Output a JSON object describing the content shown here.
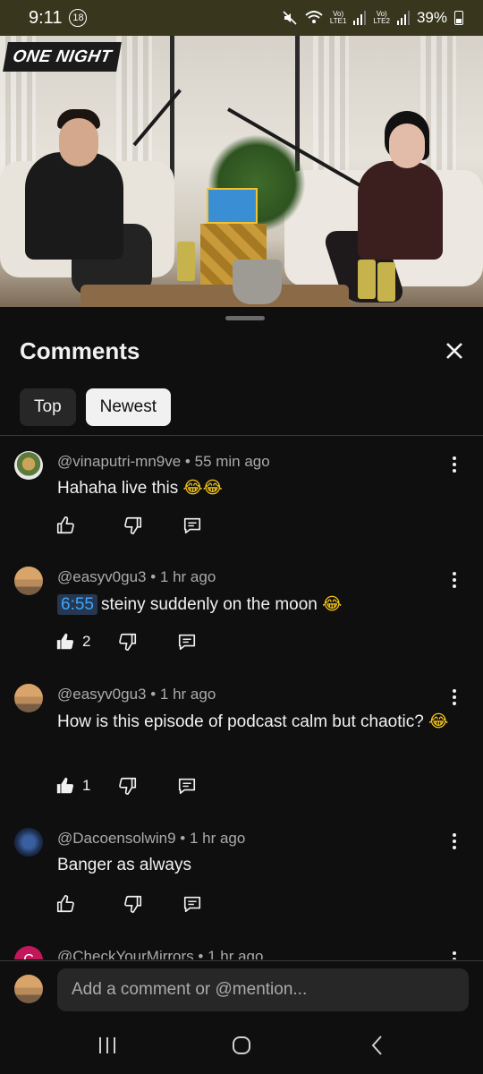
{
  "status_bar": {
    "time": "9:11",
    "notification_count": "18",
    "network_1": "Vo)\nLTE1",
    "network_2": "Vo)\nLTE2",
    "battery": "39%"
  },
  "video": {
    "logo_text": "ONE NIGHT"
  },
  "comments_panel": {
    "title": "Comments",
    "chips": [
      {
        "label": "Top",
        "selected": false
      },
      {
        "label": "Newest",
        "selected": true
      }
    ],
    "comments": [
      {
        "author": "@vinaputri-mn9ve",
        "time": "55 min ago",
        "timestamp": "",
        "text": "Hahaha live this",
        "emoji": "😂😂",
        "likes": ""
      },
      {
        "author": "@easyv0gu3",
        "time": "1 hr ago",
        "timestamp": "6:55",
        "text": "steiny suddenly on the moon",
        "emoji": "😂",
        "likes": "2"
      },
      {
        "author": "@easyv0gu3",
        "time": "1 hr ago",
        "timestamp": "",
        "text": "How is this episode of podcast calm but chaotic?",
        "emoji": "😂",
        "likes": "1"
      },
      {
        "author": "@Dacoensolwin9",
        "time": "1 hr ago",
        "timestamp": "",
        "text": "Banger as always",
        "emoji": "",
        "likes": ""
      },
      {
        "author": "@CheckYourMirrors",
        "time": "1 hr ago",
        "avatar_letter": "C"
      }
    ],
    "add_comment_placeholder": "Add a comment or @mention..."
  },
  "colors": {
    "background": "#0f0f0f",
    "status_bar": "#38371e",
    "chip_active": "#f1f1f1",
    "chip_inactive": "#272727",
    "link_blue": "#3ea6ff",
    "avatar_c": "#c2185b"
  },
  "icons": {
    "like": "thumb-up-icon",
    "dislike": "thumb-down-icon",
    "reply": "reply-icon",
    "more": "kebab-icon",
    "close": "close-icon"
  }
}
